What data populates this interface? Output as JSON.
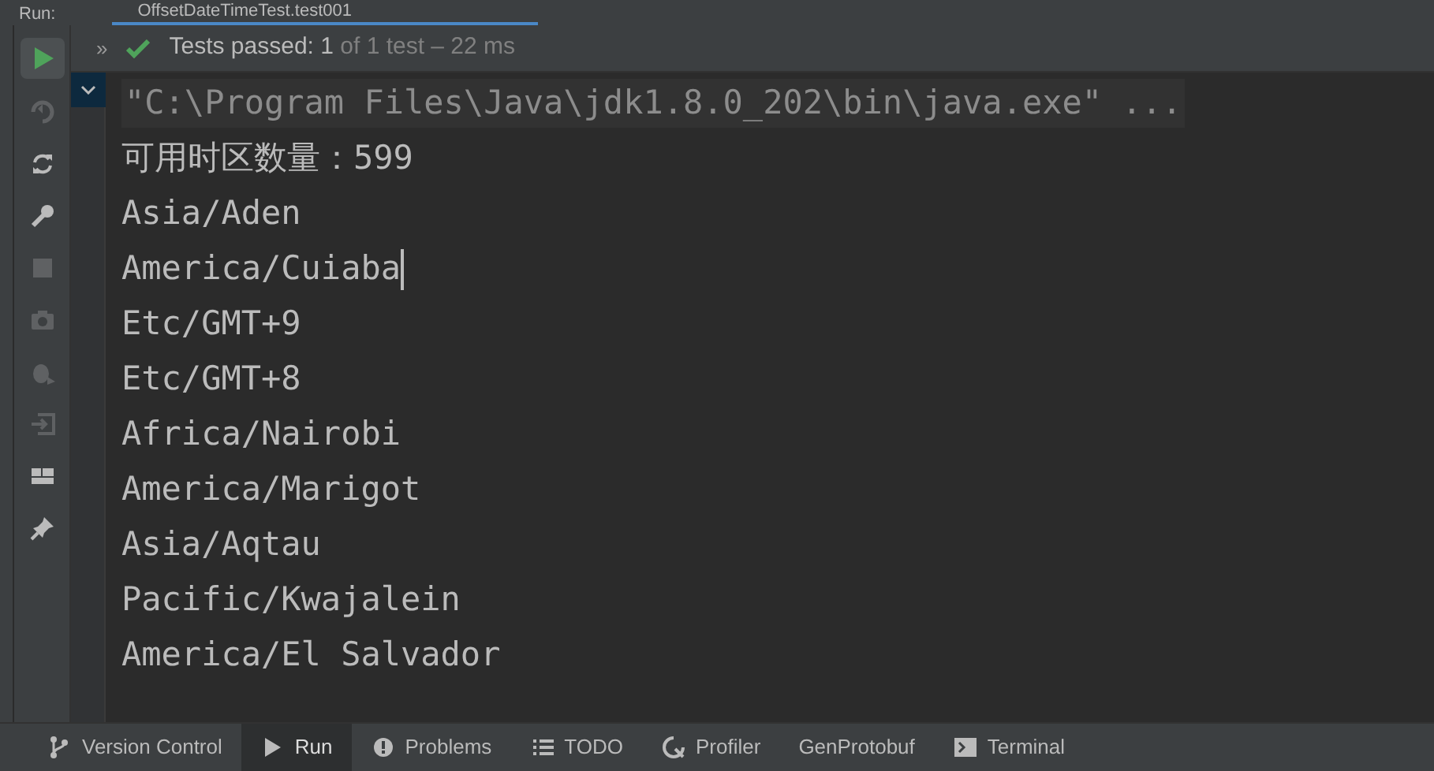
{
  "tool_window": {
    "label": "Run:",
    "tab": "OffsetDateTimeTest.test001"
  },
  "test_status": {
    "toggle": "»",
    "summary": "Tests passed: 1",
    "detail": "of 1 test – 22 ms"
  },
  "toolbar": [
    {
      "kind": "run",
      "disabled": false
    },
    {
      "kind": "rerun-failed",
      "disabled": true
    },
    {
      "kind": "rerun",
      "disabled": false
    },
    {
      "kind": "settings",
      "disabled": false
    },
    {
      "kind": "stop",
      "disabled": true
    },
    {
      "kind": "camera",
      "disabled": true
    },
    {
      "kind": "debug",
      "disabled": true
    },
    {
      "kind": "import",
      "disabled": true
    },
    {
      "kind": "layout",
      "disabled": false
    },
    {
      "kind": "pin",
      "disabled": false
    }
  ],
  "console": [
    {
      "kind": "command",
      "text": "\"C:\\Program Files\\Java\\jdk1.8.0_202\\bin\\java.exe\" ...",
      "caret": false
    },
    {
      "kind": "output",
      "text": "可用时区数量：599",
      "caret": false
    },
    {
      "kind": "output",
      "text": "Asia/Aden",
      "caret": false
    },
    {
      "kind": "output",
      "text": "America/Cuiaba",
      "caret": true
    },
    {
      "kind": "output",
      "text": "Etc/GMT+9",
      "caret": false
    },
    {
      "kind": "output",
      "text": "Etc/GMT+8",
      "caret": false
    },
    {
      "kind": "output",
      "text": "Africa/Nairobi",
      "caret": false
    },
    {
      "kind": "output",
      "text": "America/Marigot",
      "caret": false
    },
    {
      "kind": "output",
      "text": "Asia/Aqtau",
      "caret": false
    },
    {
      "kind": "output",
      "text": "Pacific/Kwajalein",
      "caret": false
    },
    {
      "kind": "output",
      "text": "America/El Salvador",
      "caret": false
    }
  ],
  "status_bar": [
    {
      "kind": "branch",
      "label": "Version Control",
      "selected": false
    },
    {
      "kind": "run",
      "label": "Run",
      "selected": true
    },
    {
      "kind": "problems",
      "label": "Problems",
      "selected": false
    },
    {
      "kind": "todo",
      "label": "TODO",
      "selected": false
    },
    {
      "kind": "profiler",
      "label": "Profiler",
      "selected": false
    },
    {
      "kind": "none",
      "label": "GenProtobuf",
      "selected": false
    },
    {
      "kind": "terminal",
      "label": "Terminal",
      "selected": false
    }
  ]
}
